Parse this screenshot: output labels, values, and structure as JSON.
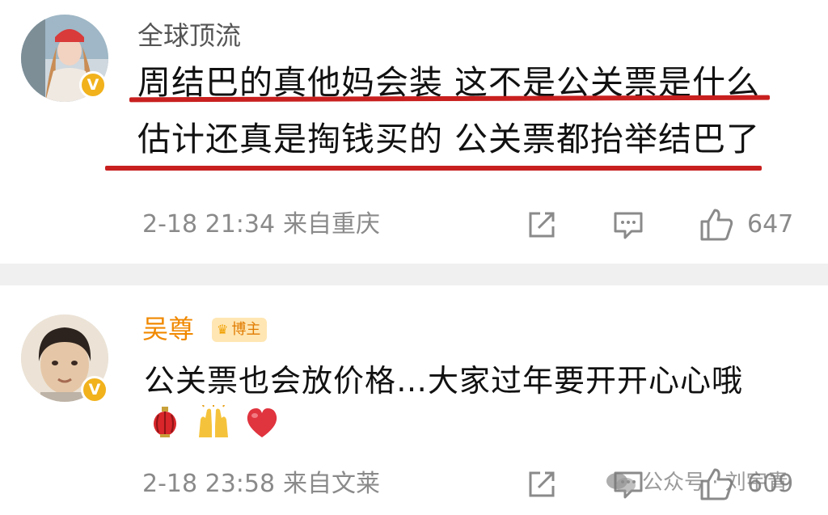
{
  "comments": [
    {
      "username": "全球顶流",
      "lines": [
        "周结巴的真他妈会装 这不是公关票是什么",
        "估计还真是掏钱买的 公关票都抬举结巴了"
      ],
      "timestamp": "2-18 21:34",
      "location": "来自重庆",
      "like_count": "647",
      "verified": "V"
    },
    {
      "username": "吴尊",
      "badge": "博主",
      "lines": [
        "公关票也会放价格…大家过年要开开心心哦"
      ],
      "emojis": [
        "lantern",
        "raised-hands",
        "red-heart"
      ],
      "timestamp": "2-18 23:58",
      "location": "来自文莱",
      "like_count": "609",
      "verified": "V"
    }
  ],
  "watermark": {
    "text": "公众号 · 刘宇青"
  },
  "colors": {
    "underline": "#c8201f",
    "verified": "#f1b21c",
    "blogger_name": "#f08800",
    "meta_text": "#8a8a8a",
    "separator": "#f0f0f0"
  }
}
